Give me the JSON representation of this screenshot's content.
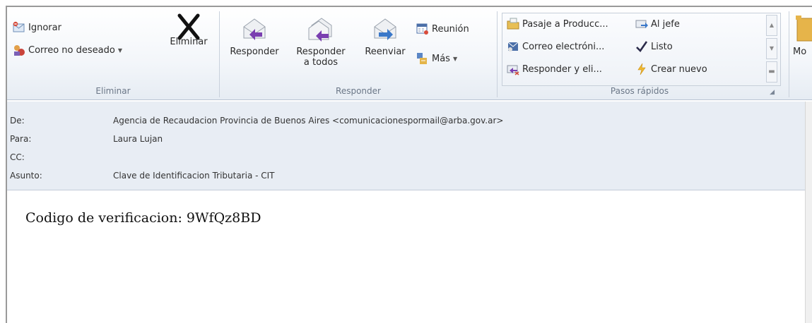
{
  "ribbon": {
    "eliminar_group": {
      "label": "Eliminar",
      "ignorar": "Ignorar",
      "correo_no_deseado": "Correo no deseado",
      "eliminar": "Eliminar"
    },
    "responder_group": {
      "label": "Responder",
      "responder": "Responder",
      "responder_todos_line1": "Responder",
      "responder_todos_line2": "a todos",
      "reenviar": "Reenviar",
      "reunion": "Reunión",
      "mas": "Más"
    },
    "pasos_group": {
      "label": "Pasos rápidos",
      "items": [
        "Pasaje a Producc...",
        "Al jefe",
        "Correo electróni...",
        "Listo",
        "Responder y eli...",
        "Crear nuevo"
      ]
    },
    "mover_partial": "Mo"
  },
  "header": {
    "de_label": "De:",
    "de_value": "Agencia de Recaudacion Provincia de Buenos Aires <comunicacionespormail@arba.gov.ar>",
    "para_label": "Para:",
    "para_value": "Laura Lujan",
    "cc_label": "CC:",
    "cc_value": "",
    "asunto_label": "Asunto:",
    "asunto_value": "Clave de Identificacion Tributaria - CIT"
  },
  "body": {
    "text": "Codigo de verificacion: 9WfQz8BD"
  },
  "colors": {
    "ribbon_bg": "#eef2f7",
    "header_bg": "#e8edf4",
    "accent_purple": "#7a3fb0",
    "accent_blue": "#3a78c9"
  }
}
